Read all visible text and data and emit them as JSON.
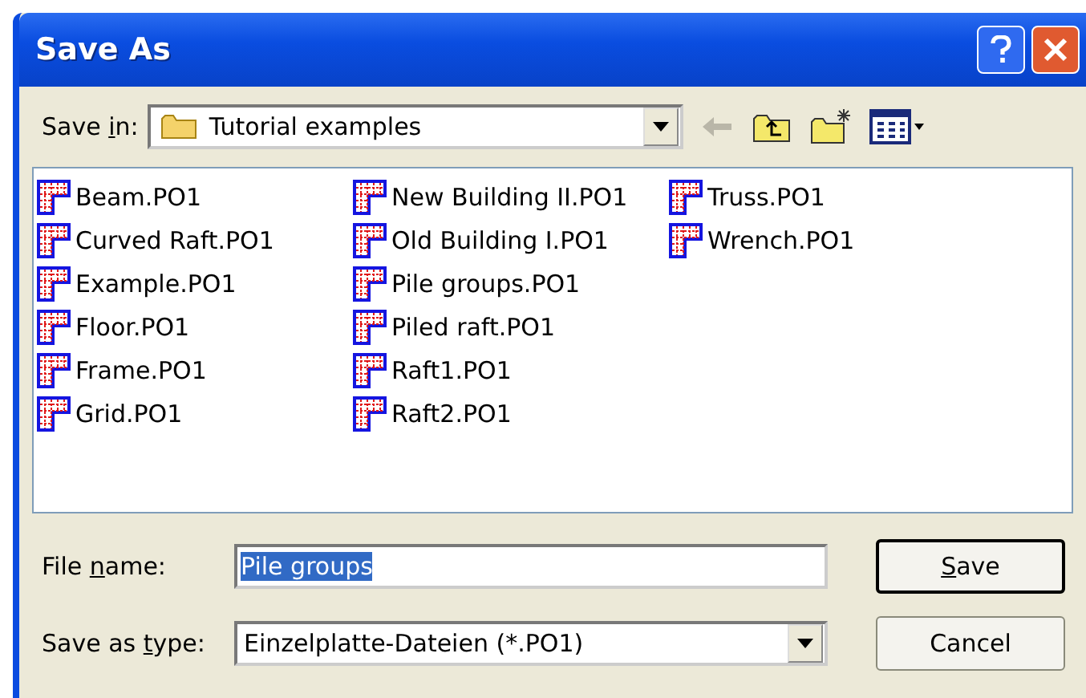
{
  "window": {
    "title": "Save As"
  },
  "save_in": {
    "label": {
      "before": "Save ",
      "key": "i",
      "after": "n:"
    },
    "value": "Tutorial examples"
  },
  "files": [
    {
      "name": "Beam.PO1"
    },
    {
      "name": "Curved Raft.PO1"
    },
    {
      "name": "Example.PO1"
    },
    {
      "name": "Floor.PO1"
    },
    {
      "name": "Frame.PO1"
    },
    {
      "name": "Grid.PO1"
    },
    {
      "name": "New Building II.PO1"
    },
    {
      "name": "Old Building I.PO1"
    },
    {
      "name": "Pile groups.PO1"
    },
    {
      "name": "Piled raft.PO1"
    },
    {
      "name": "Raft1.PO1"
    },
    {
      "name": "Raft2.PO1"
    },
    {
      "name": "Truss.PO1"
    },
    {
      "name": "Wrench.PO1"
    }
  ],
  "file_name": {
    "label": {
      "before": "File ",
      "key": "n",
      "after": "ame:"
    },
    "value": "Pile groups"
  },
  "save_as_type": {
    "label": {
      "before": "Save as ",
      "key": "t",
      "after": "ype:"
    },
    "value": "Einzelplatte-Dateien (*.PO1)"
  },
  "buttons": [
    {
      "label": {
        "key": "S",
        "after": "ave"
      },
      "default": true
    },
    {
      "label": {
        "before": "Cancel"
      },
      "default": false
    }
  ]
}
